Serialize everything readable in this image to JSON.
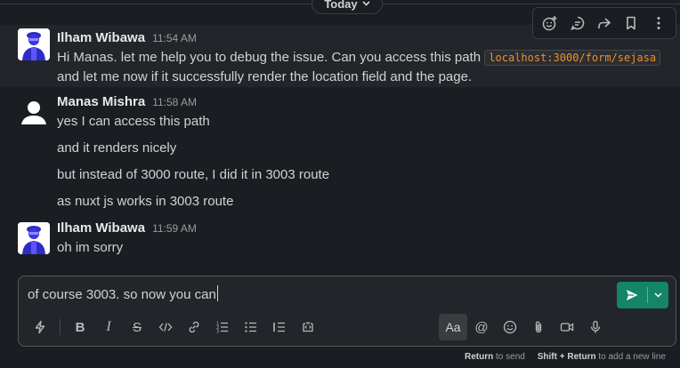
{
  "divider": {
    "label": "Today"
  },
  "hover_toolbar": {
    "icons": [
      "add-reaction-icon",
      "reply-in-thread-icon",
      "forward-icon",
      "bookmark-icon",
      "more-actions-icon"
    ]
  },
  "messages": [
    {
      "author": "Ilham Wibawa",
      "time": "11:54 AM",
      "text_before": "Hi Manas. let me help you to debug the issue. Can you access this path",
      "code": "localhost:3000/form/sejasa",
      "text_after": "and let me now if it successfully render the location field and the page."
    },
    {
      "author": "Manas Mishra",
      "time": "11:58 AM",
      "lines": [
        "yes I can access this path",
        "and it renders nicely",
        "but instead of 3000 route, I did it in 3003 route",
        "as nuxt js works in 3003 route"
      ]
    },
    {
      "author": "Ilham Wibawa",
      "time": "11:59 AM",
      "lines": [
        "oh im sorry"
      ]
    }
  ],
  "composer": {
    "value": "of course 3003. so now you can",
    "format_aa": "Aa",
    "formatting_icons": [
      "shortcuts-icon",
      "bold-icon",
      "italic-icon",
      "strikethrough-icon",
      "code-icon",
      "link-icon",
      "ordered-list-icon",
      "bulleted-list-icon",
      "blockquote-icon",
      "code-block-icon"
    ],
    "right_icons": [
      "mention-icon",
      "emoji-icon",
      "attach-icon",
      "video-icon",
      "microphone-icon"
    ]
  },
  "hint": {
    "return_key": "Return",
    "return_text": "to send",
    "shift_key": "Shift + Return",
    "shift_text": "to add a new line"
  },
  "colors": {
    "send": "#148567",
    "code_text": "#e8912d",
    "background": "#1a1d21"
  }
}
